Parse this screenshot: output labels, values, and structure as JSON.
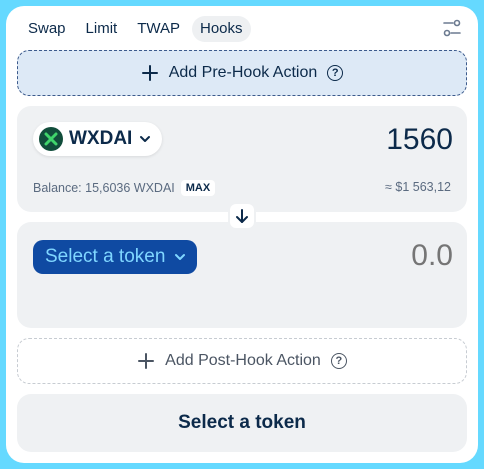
{
  "tabs": [
    {
      "label": "Swap",
      "active": false
    },
    {
      "label": "Limit",
      "active": false
    },
    {
      "label": "TWAP",
      "active": false
    },
    {
      "label": "Hooks",
      "active": true
    }
  ],
  "icons": {
    "settings": "sliders-icon",
    "plus": "plus-icon",
    "help": "question-circle-icon",
    "chevron": "chevron-down-icon",
    "arrow": "arrow-down-icon"
  },
  "pre_hook": {
    "label": "Add Pre-Hook Action",
    "help_glyph": "?"
  },
  "sell": {
    "token_symbol": "WXDAI",
    "amount": "1560",
    "balance_label": "Balance: 15,6036 WXDAI",
    "max_label": "MAX",
    "fiat_value": "≈ $1 563,12"
  },
  "buy": {
    "select_label": "Select a token",
    "amount_placeholder": "0.0"
  },
  "post_hook": {
    "label": "Add Post-Hook Action",
    "help_glyph": "?"
  },
  "cta": {
    "label": "Select a token"
  },
  "colors": {
    "background": "#65d9ff",
    "card": "#ffffff",
    "panel": "#eff1f3",
    "primary_text": "#0c2a4a",
    "select_token_bg": "#0f4aa2",
    "select_token_text": "#7fd6ff",
    "pre_hook_bg": "#dde9f6",
    "wxdai_logo": "#114d3b",
    "wxdai_mark": "#3fd46b"
  }
}
